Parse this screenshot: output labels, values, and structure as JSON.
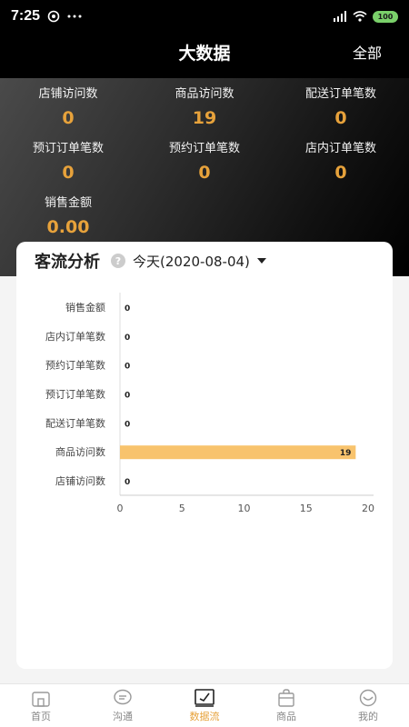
{
  "status_bar": {
    "time": "7:25",
    "battery": "100"
  },
  "header": {
    "title": "大数据",
    "action": "全部"
  },
  "stats": [
    {
      "label": "店铺访问数",
      "value": "0"
    },
    {
      "label": "商品访问数",
      "value": "19"
    },
    {
      "label": "配送订单笔数",
      "value": "0"
    },
    {
      "label": "预订订单笔数",
      "value": "0"
    },
    {
      "label": "预约订单笔数",
      "value": "0"
    },
    {
      "label": "店内订单笔数",
      "value": "0"
    },
    {
      "label": "销售金额",
      "value": "0.00"
    }
  ],
  "card": {
    "title": "客流分析",
    "help_glyph": "?",
    "date_label": "今天(2020-08-04)"
  },
  "chart_data": {
    "type": "bar",
    "orientation": "horizontal",
    "categories": [
      "销售金额",
      "店内订单笔数",
      "预约订单笔数",
      "预订订单笔数",
      "配送订单笔数",
      "商品访问数",
      "店铺访问数"
    ],
    "values": [
      0,
      0,
      0,
      0,
      0,
      19,
      0
    ],
    "xticks": [
      0,
      5,
      10,
      15,
      20
    ],
    "xlim": [
      0,
      20
    ],
    "bar_color": "#f8c36d",
    "title": "",
    "xlabel": "",
    "ylabel": ""
  },
  "tabs": [
    {
      "label": "首页",
      "icon": "home-icon",
      "active": false
    },
    {
      "label": "沟通",
      "icon": "chat-icon",
      "active": false
    },
    {
      "label": "数据流",
      "icon": "data-chart-icon",
      "active": true
    },
    {
      "label": "商品",
      "icon": "bag-icon",
      "active": false
    },
    {
      "label": "我的",
      "icon": "profile-icon",
      "active": false
    }
  ],
  "colors": {
    "accent": "#e7a23b",
    "header_bg": "#000000"
  }
}
